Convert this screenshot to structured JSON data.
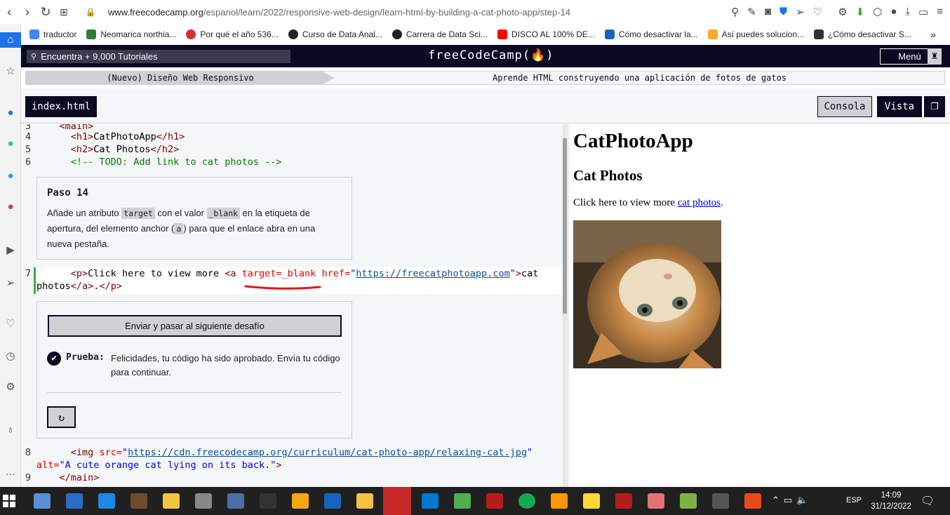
{
  "browser": {
    "url_domain": "www.freecodecamp.org",
    "url_path": "/espanol/learn/2022/responsive-web-design/learn-html-by-building-a-cat-photo-app/step-14",
    "bookmarks": [
      {
        "label": "traductor",
        "color": "#4285f4"
      },
      {
        "label": "Neomarica northia...",
        "color": "#2e7d32"
      },
      {
        "label": "Por qué el año 536...",
        "color": "#d32f2f"
      },
      {
        "label": "Curso de Data Anal...",
        "color": "#222222"
      },
      {
        "label": "Carrera de Data Sci...",
        "color": "#222222"
      },
      {
        "label": "DISCO AL 100% DE...",
        "color": "#ff0000"
      },
      {
        "label": "Cómo desactivar la...",
        "color": "#1565c0"
      },
      {
        "label": "Así puedes solucion...",
        "color": "#f9a825"
      },
      {
        "label": "¿Cómo desactivar S...",
        "color": "#333333"
      }
    ],
    "more_bookmarks": "»"
  },
  "fcc_nav": {
    "search_placeholder": "Encuentra + 9,000 Tutoriales",
    "logo": "freeCodeCamp(🔥)",
    "menu_label": "Menú"
  },
  "breadcrumb": {
    "section": "(Nuevo) Diseño Web Responsivo",
    "project": "Aprende HTML construyendo una aplicación de fotos de gatos"
  },
  "tabs": {
    "file": "index.html",
    "console": "Consola",
    "preview": "Vista"
  },
  "code": {
    "line3_num": "3",
    "line3": "<main>",
    "line4_num": "4",
    "line4_tag_open": "<h1>",
    "line4_text": "CatPhotoApp",
    "line4_tag_close": "</h1>",
    "line5_num": "5",
    "line5_tag_open": "<h2>",
    "line5_text": "Cat Photos",
    "line5_tag_close": "</h2>",
    "line6_num": "6",
    "line6": "<!-- TODO: Add link to cat photos -->",
    "line7_num": "7",
    "line7_p": "<p>",
    "line7_text": "Click here to view more ",
    "line7_a": "<a",
    "line7_target": "target=_blank",
    "line7_href_attr": "href=",
    "line7_href_val": "https://freecatphotoapp.com",
    "line7_close": ">",
    "line7_tail": "cat",
    "line7b_text": "photos",
    "line7b_close_a": "</a>",
    "line7b_dot": ".",
    "line7b_close_p": "</p>",
    "line8_num": "8",
    "line8_img": "<img",
    "line8_src_attr": "src=",
    "line8_src_val": "https://cdn.freecodecamp.org/curriculum/cat-photo-app/relaxing-cat.jpg",
    "line8b_alt": "alt=",
    "line8b_alt_val": "\"A cute orange cat lying on its back.\"",
    "line8b_close": ">",
    "line9_num": "9",
    "line9": "</main>"
  },
  "step": {
    "title": "Paso 14",
    "text_1": "Añade un atributo ",
    "code_1": "target",
    "text_2": " con el valor ",
    "code_2": "_blank",
    "text_3": " en la etiqueta de apertura, del elemento anchor (",
    "code_3": "a",
    "text_4": ") para que el enlace abra en una nueva pestaña."
  },
  "test": {
    "submit_label": "Enviar y pasar al siguiente desafío",
    "label": "Prueba:",
    "message": "Felicidades, tu código ha sido aprobado. Envía tu código para continuar."
  },
  "preview": {
    "h1": "CatPhotoApp",
    "h2": "Cat Photos",
    "p_text": "Click here to view more ",
    "link_text": "cat photos",
    "p_end": ".",
    "img_alt": "A cute orange cat lying on its back."
  },
  "taskbar": {
    "lang": "ESP",
    "time": "14:09",
    "date": "31/12/2022"
  },
  "colors": {
    "fcc_dark": "#0a0a23",
    "active_line": "#3eb044",
    "underline_annotation": "#e0161b"
  }
}
